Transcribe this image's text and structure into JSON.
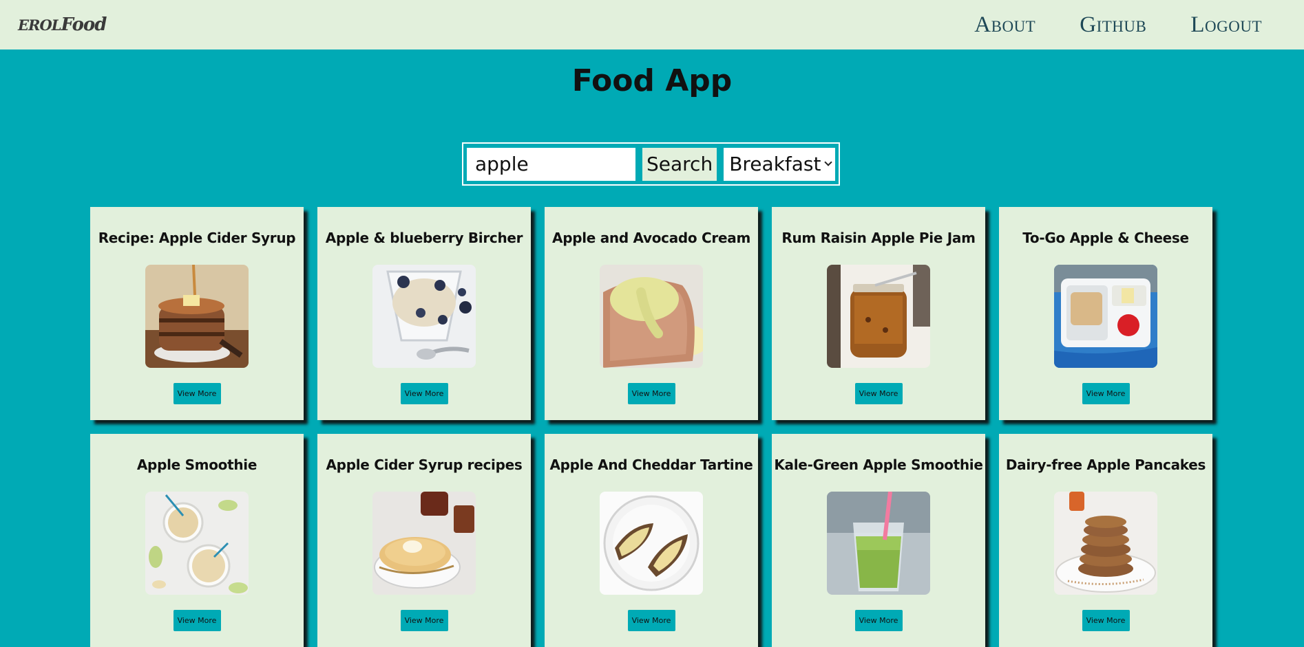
{
  "navbar": {
    "brand_prefix": "erol",
    "brand_suffix": "Food",
    "links": [
      "About",
      "Github",
      "Logout"
    ]
  },
  "page": {
    "title": "Food App"
  },
  "search": {
    "query": "apple",
    "button_label": "Search",
    "meal_type": "Breakfast"
  },
  "recipes": [
    {
      "title": "Recipe: Apple Cider Syrup",
      "button": "View More",
      "image": "pancakes-syrup"
    },
    {
      "title": "Apple & blueberry Bircher",
      "button": "View More",
      "image": "oats-blueberry"
    },
    {
      "title": "Apple and Avocado Cream",
      "button": "View More",
      "image": "toast-cream"
    },
    {
      "title": "Rum Raisin Apple Pie Jam",
      "button": "View More",
      "image": "jam-jar"
    },
    {
      "title": "To-Go Apple & Cheese",
      "button": "View More",
      "image": "lunchbox"
    },
    {
      "title": "Apple Smoothie",
      "button": "View More",
      "image": "smoothie-glasses"
    },
    {
      "title": "Apple Cider Syrup recipes",
      "button": "View More",
      "image": "pancake-plate"
    },
    {
      "title": "Apple And Cheddar Tartine",
      "button": "View More",
      "image": "tartine-plate"
    },
    {
      "title": "Kale-Green Apple Smoothie",
      "button": "View More",
      "image": "green-smoothie"
    },
    {
      "title": "Dairy-free Apple Pancakes",
      "button": "View More",
      "image": "pancake-stack"
    }
  ],
  "colors": {
    "background": "#00aab5",
    "card": "#e2f0dc",
    "navbar": "#e2f0dc",
    "nav_text": "#1e4856"
  }
}
